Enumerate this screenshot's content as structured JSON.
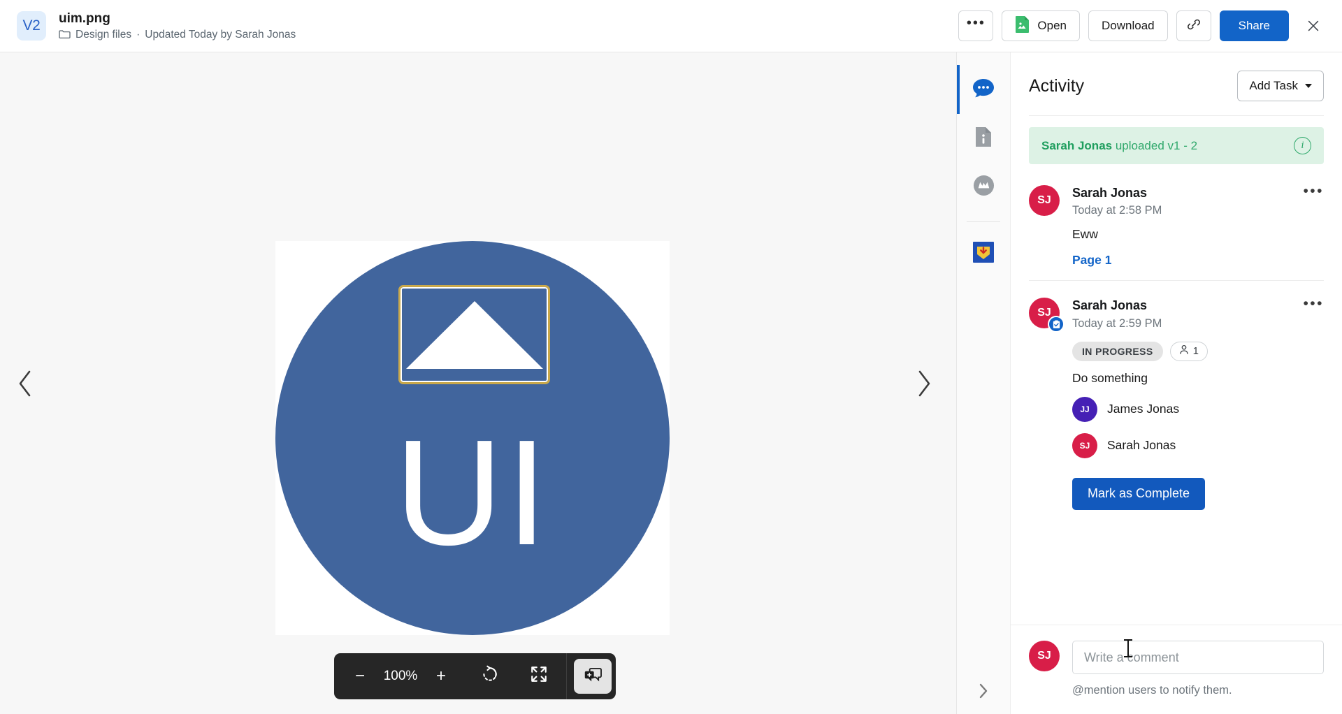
{
  "header": {
    "version_badge": "V2",
    "file_name": "uim.png",
    "folder_name": "Design files",
    "separator": "·",
    "updated_text": "Updated Today by Sarah Jonas",
    "more_label": "•••",
    "open_label": "Open",
    "download_label": "Download",
    "link_label": "copy-link",
    "share_label": "Share",
    "close_label": "Close"
  },
  "preview": {
    "logo_text": "UI",
    "prev_label": "Previous",
    "next_label": "Next",
    "toolbar": {
      "zoom_out": "−",
      "zoom_level": "100%",
      "zoom_in": "+",
      "rotate": "rotate-left",
      "fullscreen": "fullscreen",
      "add_comment": "add-comment"
    }
  },
  "rail": {
    "items": [
      {
        "name": "comments",
        "icon": "comment-bubble-icon",
        "active": true
      },
      {
        "name": "info",
        "icon": "file-info-icon",
        "active": false
      },
      {
        "name": "mentions",
        "icon": "mention-avatar-icon",
        "active": false
      },
      {
        "name": "download-app",
        "icon": "download-app-icon",
        "active": false
      }
    ],
    "collapse_label": "Collapse panel"
  },
  "activity": {
    "title": "Activity",
    "add_task_label": "Add Task",
    "upload_banner": {
      "actor": "Sarah Jonas",
      "text": " uploaded v1 - 2",
      "info_label": "i"
    },
    "comments": [
      {
        "avatar_initials": "SJ",
        "avatar_color": "#d81e48",
        "author": "Sarah Jonas",
        "time": "Today at 2:58 PM",
        "body": "Eww",
        "link": "Page 1",
        "more_label": "•••",
        "has_task_badge": false
      },
      {
        "avatar_initials": "SJ",
        "avatar_color": "#d81e48",
        "author": "Sarah Jonas",
        "time": "Today at 2:59 PM",
        "status_pill": "IN PROGRESS",
        "assignee_count": "1",
        "body": "Do something",
        "more_label": "•••",
        "has_task_badge": true,
        "assignees": [
          {
            "initials": "JJ",
            "name": "James Jonas",
            "color": "#4520b5"
          },
          {
            "initials": "SJ",
            "name": "Sarah Jonas",
            "color": "#d81e48"
          }
        ],
        "complete_label": "Mark as Complete"
      }
    ],
    "composer": {
      "avatar_initials": "SJ",
      "placeholder": "Write a comment",
      "value": "",
      "hint": "@mention users to notify them."
    }
  },
  "colors": {
    "accent": "#1264c8",
    "success": "#2fa86b",
    "avatar_red": "#d81e48",
    "avatar_purple": "#4520b5",
    "logo_blue": "#41659d",
    "logo_gold": "#c8a84b"
  }
}
